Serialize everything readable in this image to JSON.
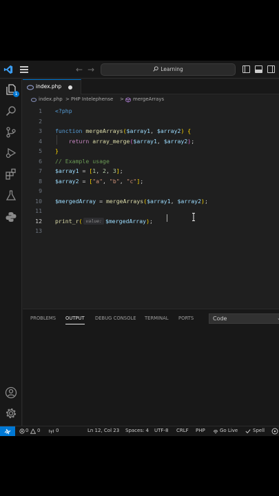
{
  "title_bar": {
    "search_text": "Learning"
  },
  "activity_bar": {
    "explorer_badge": "1"
  },
  "tab": {
    "label": "index.php"
  },
  "breadcrumb": {
    "file": "index.php",
    "sep1": ">",
    "extension": "PHP Intelephense",
    "sep2": ">",
    "symbol": "mergeArrays"
  },
  "editor": {
    "line_numbers": [
      "1",
      "2",
      "3",
      "4",
      "5",
      "6",
      "7",
      "8",
      "9",
      "10",
      "11",
      "12",
      "13"
    ],
    "active_line": "12",
    "lines": [
      [
        {
          "t": "<?php",
          "c": "tag"
        }
      ],
      [],
      [
        {
          "t": "function ",
          "c": "kw2"
        },
        {
          "t": "mergeArrays",
          "c": "fn"
        },
        {
          "t": "(",
          "c": "br1"
        },
        {
          "t": "$array1",
          "c": "var"
        },
        {
          "t": ", ",
          "c": "pun"
        },
        {
          "t": "$array2",
          "c": "var"
        },
        {
          "t": ")",
          "c": "br1"
        },
        {
          "t": " {",
          "c": "br1"
        }
      ],
      [
        {
          "t": "    ",
          "c": "pun"
        },
        {
          "t": "return ",
          "c": "kw"
        },
        {
          "t": "array_merge",
          "c": "fn"
        },
        {
          "t": "(",
          "c": "br2"
        },
        {
          "t": "$array1",
          "c": "var"
        },
        {
          "t": ", ",
          "c": "pun"
        },
        {
          "t": "$array2",
          "c": "var"
        },
        {
          "t": ")",
          "c": "br2"
        },
        {
          "t": ";",
          "c": "pun"
        }
      ],
      [
        {
          "t": "}",
          "c": "br1"
        }
      ],
      [
        {
          "t": "// Example usage",
          "c": "cmt"
        }
      ],
      [
        {
          "t": "$array1",
          "c": "var"
        },
        {
          "t": " = ",
          "c": "pun"
        },
        {
          "t": "[",
          "c": "br1"
        },
        {
          "t": "1",
          "c": "num"
        },
        {
          "t": ", ",
          "c": "pun"
        },
        {
          "t": "2",
          "c": "num"
        },
        {
          "t": ", ",
          "c": "pun"
        },
        {
          "t": "3",
          "c": "num"
        },
        {
          "t": "]",
          "c": "br1"
        },
        {
          "t": ";",
          "c": "pun"
        }
      ],
      [
        {
          "t": "$array2",
          "c": "var"
        },
        {
          "t": " = ",
          "c": "pun"
        },
        {
          "t": "[",
          "c": "br1"
        },
        {
          "t": "\"a\"",
          "c": "str"
        },
        {
          "t": ", ",
          "c": "pun"
        },
        {
          "t": "\"b\"",
          "c": "str"
        },
        {
          "t": ", ",
          "c": "pun"
        },
        {
          "t": "\"c\"",
          "c": "str"
        },
        {
          "t": "]",
          "c": "br1"
        },
        {
          "t": ";",
          "c": "pun"
        }
      ],
      [],
      [
        {
          "t": "$mergedArray",
          "c": "var"
        },
        {
          "t": " = ",
          "c": "pun"
        },
        {
          "t": "mergeArrays",
          "c": "fn"
        },
        {
          "t": "(",
          "c": "br1"
        },
        {
          "t": "$array1",
          "c": "var"
        },
        {
          "t": ", ",
          "c": "pun"
        },
        {
          "t": "$array2",
          "c": "var"
        },
        {
          "t": ")",
          "c": "br1"
        },
        {
          "t": ";",
          "c": "pun"
        }
      ],
      [],
      [
        {
          "t": "print_r",
          "c": "fn"
        },
        {
          "t": "(",
          "c": "br1"
        },
        {
          "t": "value:",
          "c": "hint"
        },
        {
          "t": "$mergedArray",
          "c": "var"
        },
        {
          "t": ")",
          "c": "br1"
        },
        {
          "t": ";",
          "c": "pun"
        }
      ],
      []
    ]
  },
  "panel": {
    "tabs": [
      "PROBLEMS",
      "OUTPUT",
      "DEBUG CONSOLE",
      "TERMINAL",
      "PORTS"
    ],
    "active_tab": "OUTPUT",
    "output_source": "Code"
  },
  "status_bar": {
    "errors": "0",
    "warnings": "0",
    "ports": "0",
    "position": "Ln 12, Col 23",
    "indent": "Spaces: 4",
    "encoding": "UTF-8",
    "eol": "CRLF",
    "language": "PHP",
    "go_live": "Go Live",
    "spell": "Spell"
  },
  "colors": {
    "accent": "#0078d4",
    "editor_bg": "#1f1f1f",
    "chrome_bg": "#181818"
  }
}
